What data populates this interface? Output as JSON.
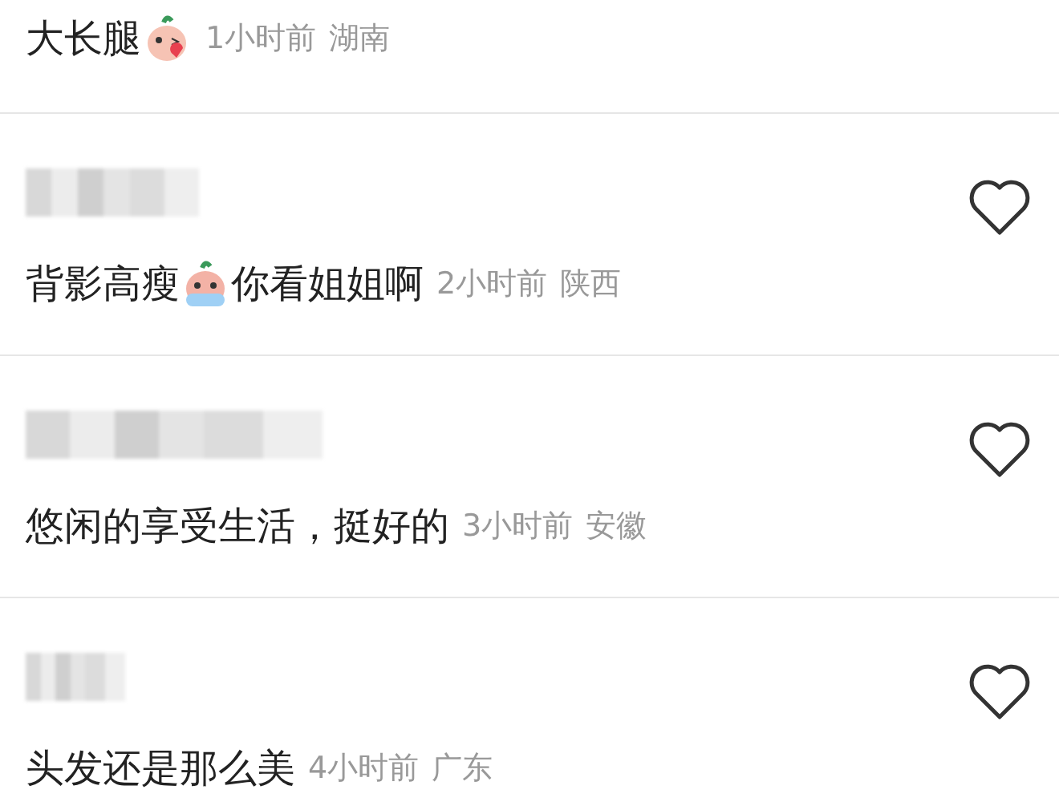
{
  "comments": [
    {
      "segments": [
        {
          "kind": "text",
          "text": "大长腿"
        },
        {
          "kind": "emoji"
        }
      ],
      "time": "1小时前",
      "location": "湖南"
    },
    {
      "username_blurred": true,
      "liked": false,
      "segments": [
        {
          "kind": "text",
          "text": "背影高瘦"
        },
        {
          "kind": "emoji"
        },
        {
          "kind": "text",
          "text": "你看姐姐啊"
        }
      ],
      "time": "2小时前",
      "location": "陕西"
    },
    {
      "username_blurred": true,
      "liked": false,
      "segments": [
        {
          "kind": "text",
          "text": "悠闲的享受生活，挺好的"
        }
      ],
      "time": "3小时前",
      "location": "安徽"
    },
    {
      "username_blurred": true,
      "liked": false,
      "segments": [
        {
          "kind": "text",
          "text": "头发还是那么美"
        }
      ],
      "time": "4小时前",
      "location": "广东"
    }
  ]
}
